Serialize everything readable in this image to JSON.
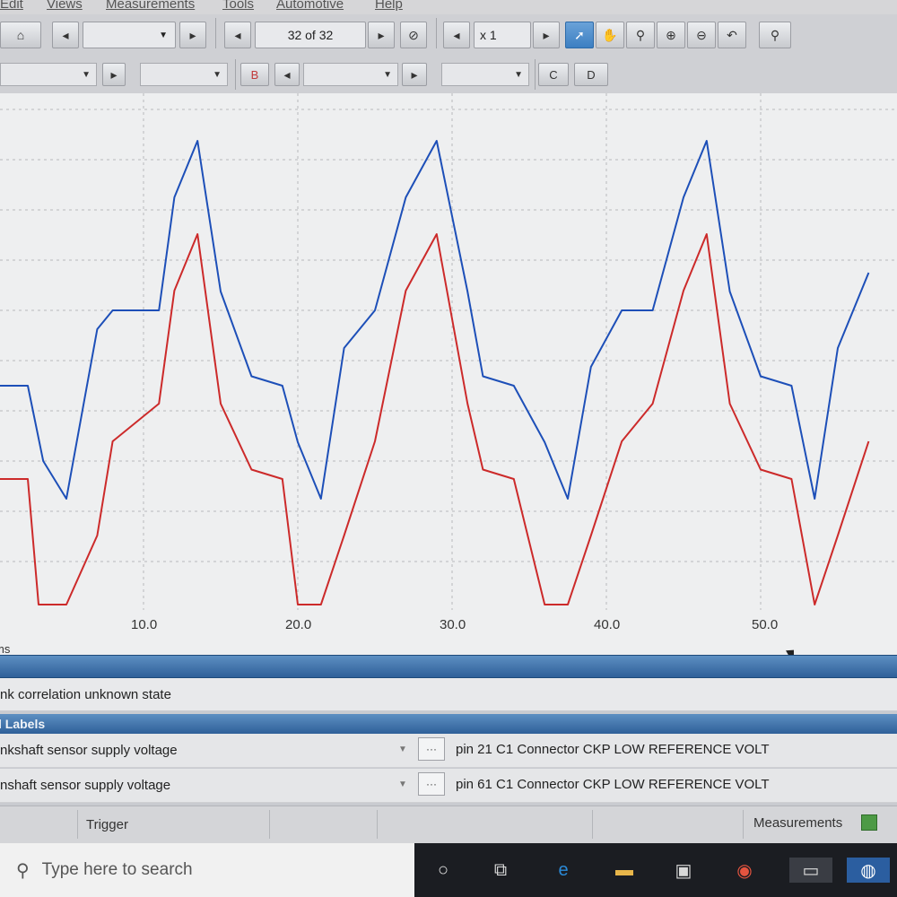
{
  "menu": {
    "items": [
      "Edit",
      "Views",
      "Measurements",
      "Tools",
      "Automotive",
      "Help"
    ]
  },
  "toolbar": {
    "buffer_label": "32 of 32",
    "zoom_label": "x 1",
    "channel_b": "B",
    "channel_c": "C",
    "channel_d": "D"
  },
  "plot": {
    "x_ticks": [
      "10.0",
      "20.0",
      "30.0",
      "40.0",
      "50.0"
    ],
    "x_unit_partial": "ms",
    "colors": {
      "series_a": "#1d4fb8",
      "series_b": "#cc2a2a",
      "grid": "#b8b9bc",
      "background": "#eeeff0"
    }
  },
  "chart_data": {
    "type": "line",
    "x_ticks": [
      10.0,
      20.0,
      30.0,
      40.0,
      50.0
    ],
    "xlabel": "ms",
    "series": [
      {
        "color": "#1d4fb8",
        "x": [
          0,
          2.5,
          3.5,
          5,
          7,
          8,
          11,
          12,
          13.5,
          15,
          17,
          19,
          20,
          21.5,
          23,
          25,
          27,
          29,
          31,
          32,
          34,
          36,
          37.5,
          39,
          41,
          43,
          45,
          46.5,
          48,
          50,
          52,
          53.5,
          55,
          57
        ],
        "y": [
          0,
          0,
          -0.4,
          -0.6,
          0.3,
          0.4,
          0.4,
          1.0,
          1.3,
          0.5,
          0.05,
          0,
          -0.3,
          -0.6,
          0.2,
          0.4,
          1.0,
          1.3,
          0.5,
          0.05,
          0,
          -0.3,
          -0.6,
          0.1,
          0.4,
          0.4,
          1.0,
          1.3,
          0.5,
          0.05,
          0,
          -0.6,
          0.2,
          0.6
        ]
      },
      {
        "color": "#cc2a2a",
        "x": [
          0,
          2.5,
          3.2,
          5,
          7,
          8,
          11,
          12,
          13.5,
          15,
          17,
          19,
          20,
          21.5,
          23,
          25,
          27,
          29,
          31,
          32,
          34,
          36,
          37.5,
          39,
          41,
          43,
          45,
          46.5,
          48,
          50,
          52,
          53.5,
          55,
          57
        ],
        "y": [
          0,
          0,
          -1,
          -1,
          -0.3,
          0.2,
          0.4,
          1.0,
          1.3,
          0.4,
          0.05,
          0,
          -1,
          -1,
          -0.3,
          0.2,
          1.0,
          1.3,
          0.4,
          0.05,
          0,
          -1,
          -1,
          -0.3,
          0.2,
          0.4,
          1.0,
          1.3,
          0.4,
          0.05,
          0,
          -1,
          -0.3,
          0.2
        ]
      }
    ],
    "grid": true
  },
  "status": {
    "text": "nk correlation unknown state"
  },
  "labels": {
    "header": "l Labels",
    "rows": [
      {
        "name": "nkshaft sensor supply voltage",
        "desc": "pin 21 C1 Connector CKP LOW REFERENCE VOLT"
      },
      {
        "name": "nshaft sensor supply voltage",
        "desc": "pin 61 C1 Connector CKP LOW REFERENCE VOLT"
      }
    ]
  },
  "bottom": {
    "trigger": "Trigger",
    "measurements": "Measurements"
  },
  "taskbar": {
    "search_placeholder": "Type here to search"
  }
}
